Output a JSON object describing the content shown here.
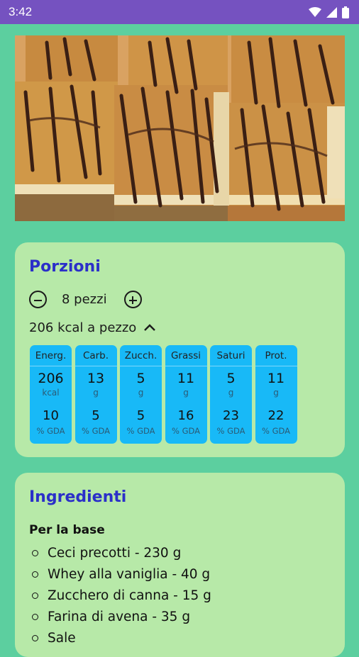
{
  "status_bar": {
    "time": "3:42",
    "icons": [
      "wifi-icon",
      "signal-icon",
      "battery-icon"
    ]
  },
  "hero_image": {
    "subject": "peanut butter chickpea bars with chocolate drizzle"
  },
  "portions": {
    "title": "Porzioni",
    "count_label": "8 pezzi",
    "kcal_label": "206 kcal a pezzo",
    "nutrients": [
      {
        "name": "Energ.",
        "value": "206",
        "unit": "kcal",
        "pct": "10",
        "gda": "% GDA"
      },
      {
        "name": "Carb.",
        "value": "13",
        "unit": "g",
        "pct": "5",
        "gda": "% GDA"
      },
      {
        "name": "Zucch.",
        "value": "5",
        "unit": "g",
        "pct": "5",
        "gda": "% GDA"
      },
      {
        "name": "Grassi",
        "value": "11",
        "unit": "g",
        "pct": "16",
        "gda": "% GDA"
      },
      {
        "name": "Saturi",
        "value": "5",
        "unit": "g",
        "pct": "23",
        "gda": "% GDA"
      },
      {
        "name": "Prot.",
        "value": "11",
        "unit": "g",
        "pct": "22",
        "gda": "% GDA"
      }
    ]
  },
  "ingredients": {
    "title": "Ingredienti",
    "section": "Per la base",
    "items": [
      "Ceci precotti - 230 g",
      "Whey alla vaniglia - 40 g",
      "Zucchero di canna - 15 g",
      "Farina di avena - 35 g",
      "Sale"
    ]
  },
  "colors": {
    "status_bar": "#7552c0",
    "background": "#5ccf9f",
    "card": "#b7e9a8",
    "title": "#2b2fc9",
    "nutrient_tile": "#18b9f7"
  }
}
